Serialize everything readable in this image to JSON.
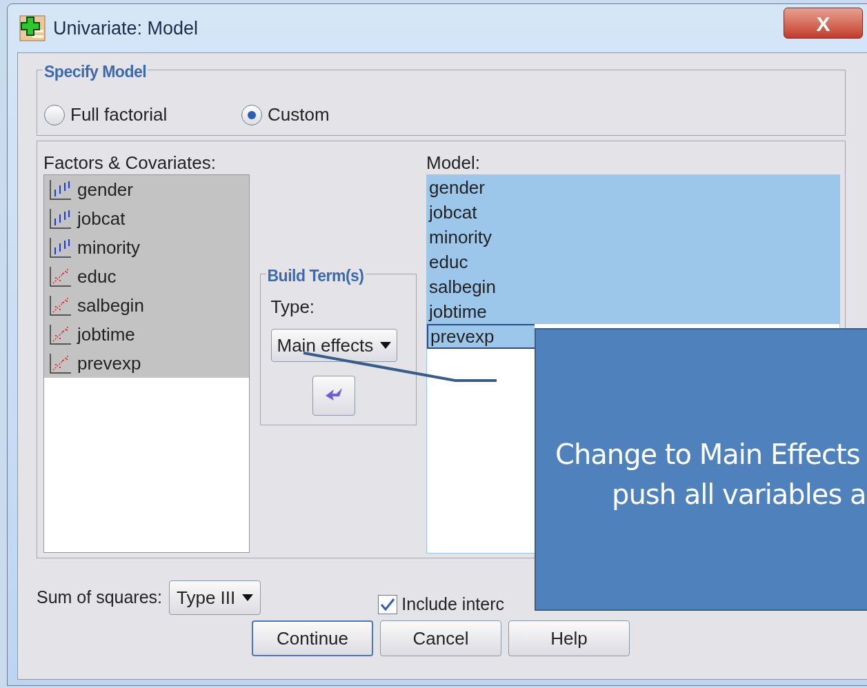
{
  "window": {
    "title": "Univariate: Model",
    "close": "X"
  },
  "specify_model": {
    "title": "Specify Model",
    "options": [
      {
        "label": "Full factorial",
        "selected": false
      },
      {
        "label": "Custom",
        "selected": true
      }
    ]
  },
  "factors": {
    "label": "Factors & Covariates:",
    "items": [
      {
        "name": "gender",
        "kind": "nominal",
        "selected": true
      },
      {
        "name": "jobcat",
        "kind": "nominal",
        "selected": true
      },
      {
        "name": "minority",
        "kind": "nominal",
        "selected": true
      },
      {
        "name": "educ",
        "kind": "scale",
        "selected": true
      },
      {
        "name": "salbegin",
        "kind": "scale",
        "selected": true
      },
      {
        "name": "jobtime",
        "kind": "scale",
        "selected": true
      },
      {
        "name": "prevexp",
        "kind": "scale",
        "selected": true
      }
    ]
  },
  "build_terms": {
    "title": "Build Term(s)",
    "type_label": "Type:",
    "type_value": "Main effects"
  },
  "model": {
    "label": "Model:",
    "items": [
      {
        "name": "gender",
        "selected": true
      },
      {
        "name": "jobcat",
        "selected": true
      },
      {
        "name": "minority",
        "selected": true
      },
      {
        "name": "educ",
        "selected": true
      },
      {
        "name": "salbegin",
        "selected": true
      },
      {
        "name": "jobtime",
        "selected": true
      },
      {
        "name": "prevexp",
        "selected": true
      }
    ]
  },
  "sum_of_squares": {
    "label": "Sum of squares:",
    "value": "Type III"
  },
  "include_intercept": {
    "label": "Include interc",
    "checked": true
  },
  "buttons": [
    "Continue",
    "Cancel",
    "Help"
  ],
  "callout": {
    "lines": [
      "Change to Main Effects",
      "push all variables a"
    ]
  }
}
